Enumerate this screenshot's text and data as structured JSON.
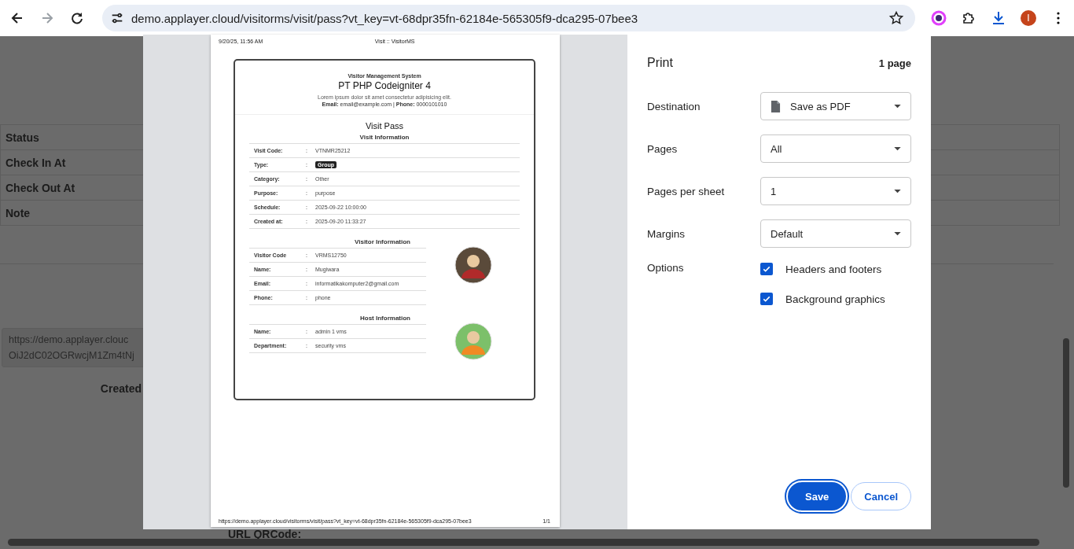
{
  "browser": {
    "url": "demo.applayer.cloud/visitorms/visit/pass?vt_key=vt-68dpr35fn-62184e-565305f9-dca295-07bee3",
    "profile_initial": "I"
  },
  "background_page": {
    "table_rows": [
      "Status",
      "Check In At",
      "Check Out At",
      "Note"
    ],
    "url_box_lines": [
      "https://demo.applayer.clouc",
      "OiJ2dC02OGRwcjM1Zm4tNj"
    ],
    "created_label": "Created",
    "qrcode_label": "URL QRCode:"
  },
  "print_preview": {
    "header_left": "9/20/25, 11:56 AM",
    "header_center": "Visit :: VisitorMS",
    "footer_url": "https://demo.applayer.cloud/visitorms/visit/pass?vt_key=vt-68dpr35fn-62184e-565305f9-dca295-07bee3",
    "footer_page": "1/1",
    "card": {
      "system": "Visitor Management System",
      "company": "PT PHP Codeigniter 4",
      "tagline": "Lorem ipsum dolor sit amet consectetur adipisicing elit.",
      "contact": "**Email:** email@example.com | **Phone:** 0000101010",
      "title": "Visit Pass",
      "sections": [
        {
          "heading": "Visit Information",
          "avatar": false,
          "rows": [
            {
              "label": "Visit Code:",
              "sep": ":",
              "value": "VTNMR25212",
              "kind": "text"
            },
            {
              "label": "Type:",
              "sep": ":",
              "value": "Group",
              "kind": "badge"
            },
            {
              "label": "Category:",
              "sep": ":",
              "value": "Other",
              "kind": "text"
            },
            {
              "label": "Purpose:",
              "sep": ":",
              "value": "purpose",
              "kind": "text"
            },
            {
              "label": "Schedule:",
              "sep": ":",
              "value": "2025-09-22 10:00:00",
              "kind": "text"
            },
            {
              "label": "Created at:",
              "sep": ":",
              "value": "2025-09-20 11:33:27",
              "kind": "text"
            }
          ]
        },
        {
          "heading": "Visitor Information",
          "avatar": true,
          "rows": [
            {
              "label": "Visitor Code",
              "sep": ":",
              "value": "VRMS12750",
              "kind": "text"
            },
            {
              "label": "Name:",
              "sep": ":",
              "value": "Mugiwara",
              "kind": "text"
            },
            {
              "label": "Email:",
              "sep": ":",
              "value": "informatikakomputer2@gmail.com",
              "kind": "text"
            },
            {
              "label": "Phone:",
              "sep": ":",
              "value": "phone",
              "kind": "text"
            }
          ]
        },
        {
          "heading": "Host Information",
          "avatar": true,
          "rows": [
            {
              "label": "Name:",
              "sep": ":",
              "value": "admin 1 vms",
              "kind": "text"
            },
            {
              "label": "Department:",
              "sep": ":",
              "value": "security vms",
              "kind": "text"
            }
          ]
        }
      ]
    }
  },
  "print_settings": {
    "title": "Print",
    "page_count": "1 page",
    "fields": [
      {
        "label": "Destination",
        "value": "Save as PDF",
        "kind": "file"
      },
      {
        "label": "Pages",
        "value": "All",
        "kind": "plain"
      },
      {
        "label": "Pages per sheet",
        "value": "1",
        "kind": "plain"
      },
      {
        "label": "Margins",
        "value": "Default",
        "kind": "plain"
      }
    ],
    "options_label": "Options",
    "options": [
      {
        "label": "Headers and footers",
        "checked": true
      },
      {
        "label": "Background graphics",
        "checked": true
      }
    ],
    "buttons": [
      {
        "label": "Save",
        "kind": "primary"
      },
      {
        "label": "Cancel",
        "kind": "secondary"
      }
    ]
  }
}
